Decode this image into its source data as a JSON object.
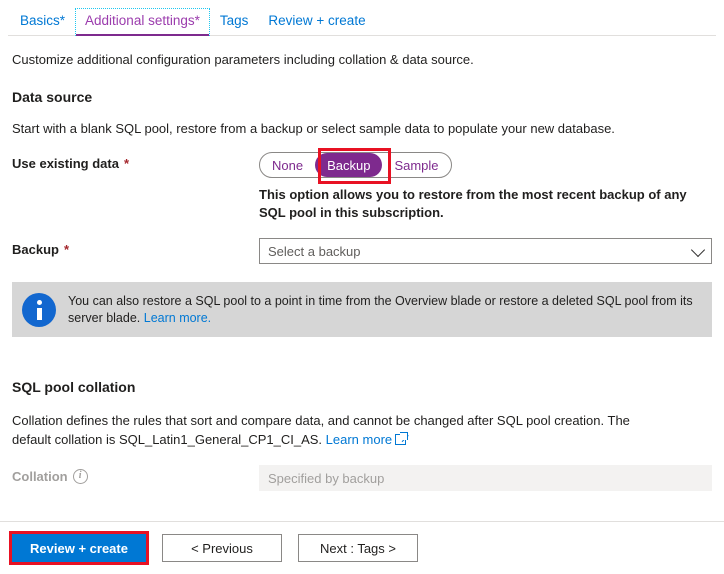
{
  "tabs": [
    {
      "label": "Basics",
      "required": "*",
      "active": false
    },
    {
      "label": "Additional settings",
      "required": "*",
      "active": true
    },
    {
      "label": "Tags",
      "required": "",
      "active": false
    },
    {
      "label": "Review + create",
      "required": "",
      "active": false
    }
  ],
  "intro": "Customize additional configuration parameters including collation & data source.",
  "data_source": {
    "heading": "Data source",
    "description": "Start with a blank SQL pool, restore from a backup or select sample data to populate your new database.",
    "use_existing_data": {
      "label": "Use existing data",
      "required": "*",
      "options": [
        "None",
        "Backup",
        "Sample"
      ],
      "selected": "Backup",
      "help_text": "This option allows you to restore from the most recent backup of any SQL pool in this subscription."
    },
    "backup": {
      "label": "Backup",
      "required": "*",
      "placeholder": "Select a backup",
      "value": "Select a backup"
    },
    "banner": {
      "text": "You can also restore a SQL pool to a point in time from the Overview blade or restore a deleted SQL pool from its server blade.",
      "link": "Learn more."
    }
  },
  "collation_section": {
    "heading": "SQL pool collation",
    "description": "Collation defines the rules that sort and compare data, and cannot be changed after SQL pool creation. The default collation is SQL_Latin1_General_CP1_CI_AS.",
    "link": "Learn more",
    "field": {
      "label": "Collation",
      "value": "Specified by backup"
    }
  },
  "footer": {
    "review_create": "Review + create",
    "previous": "< Previous",
    "next": "Next : Tags >"
  },
  "colors": {
    "accent_blue": "#0078d4",
    "purple": "#7e2a8e",
    "annotation_red": "#e81123",
    "required_red": "#a4262c",
    "banner_bg": "#d6d6d6",
    "banner_icon_blue": "#1267cf"
  }
}
